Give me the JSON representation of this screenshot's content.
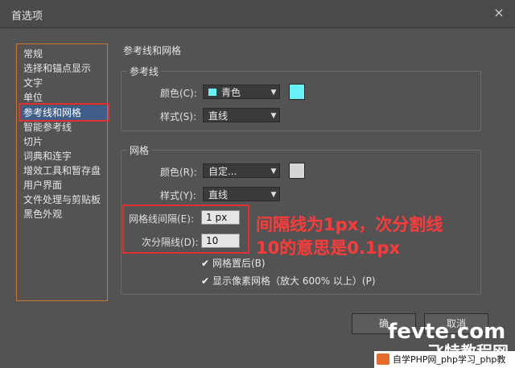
{
  "window": {
    "title": "首选项",
    "close_glyph": "×"
  },
  "sidebar": {
    "items": [
      {
        "label": "常规"
      },
      {
        "label": "选择和锚点显示"
      },
      {
        "label": "文字"
      },
      {
        "label": "单位"
      },
      {
        "label": "参考线和网格",
        "selected": true
      },
      {
        "label": "智能参考线"
      },
      {
        "label": "切片"
      },
      {
        "label": "词典和连字"
      },
      {
        "label": "增效工具和暂存盘"
      },
      {
        "label": "用户界面"
      },
      {
        "label": "文件处理与剪贴板"
      },
      {
        "label": "黑色外观"
      }
    ]
  },
  "main": {
    "section_title": "参考线和网格",
    "guides": {
      "title": "参考线",
      "color_label": "颜色(C):",
      "color_value": "青色",
      "color_swatch": "#67f3f7",
      "style_label": "样式(S):",
      "style_value": "直线"
    },
    "grid": {
      "title": "网格",
      "color_label": "颜色(R):",
      "color_value": "自定...",
      "color_swatch": "#d6d6d6",
      "style_label": "样式(Y):",
      "style_value": "直线",
      "gridline_every_label": "网格线间隔(E):",
      "gridline_every_value": "1 px",
      "subdivisions_label": "次分隔线(D):",
      "subdivisions_value": "10",
      "grids_in_back_label": "网格置后(B)",
      "grids_in_back_checked": true,
      "pixel_grid_label": "显示像素网格（放大 600% 以上）(P)",
      "pixel_grid_checked": true
    }
  },
  "annotation": {
    "line1": "间隔线为1px，次分割线",
    "line2": "10的意思是0.1px",
    "color": "#ff3a3a"
  },
  "buttons": {
    "ok": "确",
    "cancel": "取消"
  },
  "watermark": {
    "main": "fevte.com",
    "sub": "飞特教程网",
    "bar": "自学PHP网_php学习_php教"
  }
}
